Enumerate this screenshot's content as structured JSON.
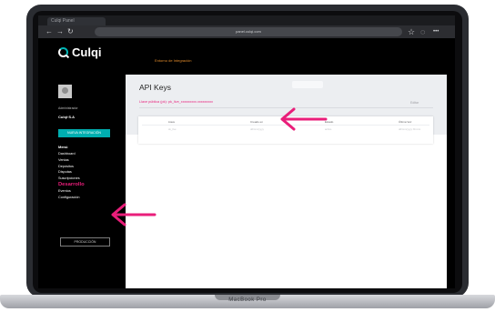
{
  "laptop": {
    "model": "MacBook Pro"
  },
  "browser": {
    "tab_title": "Culqi Panel",
    "back": "←",
    "forward": "→",
    "reload": "↻",
    "address": "panel.culqi.com",
    "star": "☆",
    "profile": "◌",
    "menu": "•••"
  },
  "app": {
    "logo_text": "Culqi",
    "environment": "Entorno de Integración",
    "sidebar": {
      "role": "Administrador",
      "username": "Culqi·S.A",
      "action_button": "NUEVA INTEGRACIÓN",
      "menu_title": "Menú",
      "items": [
        {
          "label": "Dashboard",
          "active": false
        },
        {
          "label": "Ventas",
          "active": false
        },
        {
          "label": "Depósitos",
          "active": false
        },
        {
          "label": "Disputas",
          "active": false
        },
        {
          "label": "Suscripciones",
          "active": false
        },
        {
          "label": "Desarrollo",
          "active": true
        },
        {
          "label": "Eventos",
          "active": false
        },
        {
          "label": "Configuración",
          "active": false
        }
      ],
      "mode_button": "PRODUCCIÓN"
    },
    "main": {
      "title": "API Keys",
      "public_key": "Llave pública (pk): pk_live_xxxxxxxxx.xxxxxxxxx",
      "edit_link": "Editar",
      "table": {
        "columns": [
          "Llave",
          "Creado en",
          "Estado",
          "Última Vez"
        ],
        "row": [
          "sk_live",
          "dd/mm/yyyy",
          "activo",
          "dd/mm/yyyy hh:mm"
        ]
      }
    }
  },
  "colors": {
    "accent_pink": "#e91e7a",
    "brand_teal": "#00aeb0"
  }
}
